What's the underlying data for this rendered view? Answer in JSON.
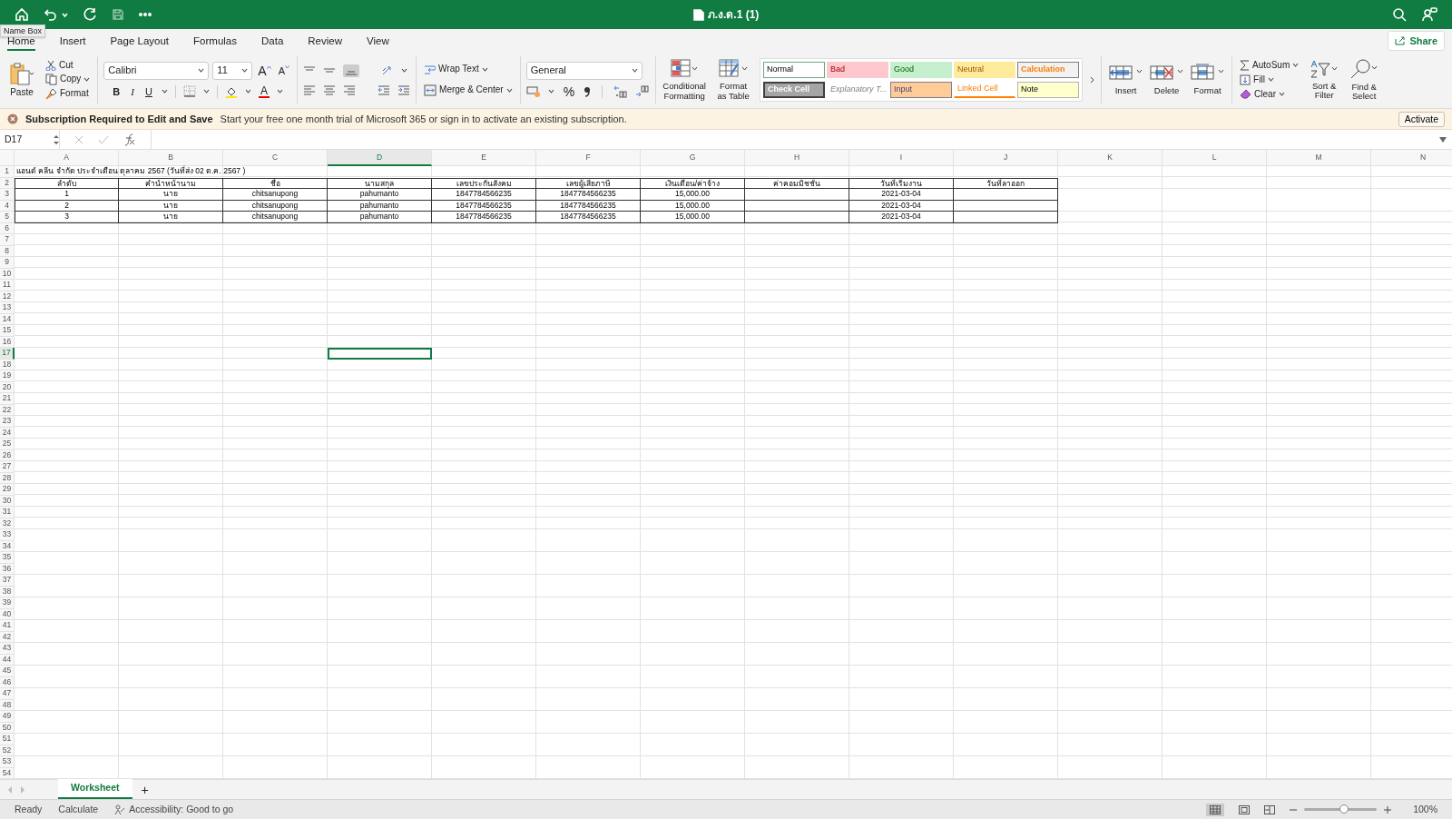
{
  "title_bar": {
    "title": "ภ.ง.ด.1 (1)"
  },
  "tooltip": "Name Box",
  "tabs": [
    {
      "label": "Home",
      "selected": true
    },
    {
      "label": "Insert",
      "selected": false
    },
    {
      "label": "Page Layout",
      "selected": false
    },
    {
      "label": "Formulas",
      "selected": false
    },
    {
      "label": "Data",
      "selected": false
    },
    {
      "label": "Review",
      "selected": false
    },
    {
      "label": "View",
      "selected": false
    }
  ],
  "share": "Share",
  "ribbon": {
    "clipboard": {
      "paste": "Paste",
      "cut": "Cut",
      "copy": "Copy",
      "format": "Format"
    },
    "font": {
      "name": "Calibri",
      "size": "11",
      "grow": "A",
      "shrink": "A",
      "bold": "B",
      "italic": "I",
      "underline": "U",
      "color_letter": "A"
    },
    "alignment": {
      "wrap": "Wrap Text",
      "merge": "Merge & Center"
    },
    "number": {
      "format": "General",
      "percent": "%"
    },
    "styles": {
      "conditional": "Conditional Formatting",
      "format_table": "Format as Table",
      "cells": [
        {
          "kind": "normal",
          "label": "Normal"
        },
        {
          "kind": "bad",
          "label": "Bad"
        },
        {
          "kind": "good",
          "label": "Good"
        },
        {
          "kind": "neutral",
          "label": "Neutral"
        },
        {
          "kind": "calculation",
          "label": "Calculation"
        },
        {
          "kind": "check",
          "label": "Check Cell"
        },
        {
          "kind": "explanatory",
          "label": "Explanatory T..."
        },
        {
          "kind": "input",
          "label": "Input"
        },
        {
          "kind": "linked",
          "label": "Linked Cell"
        },
        {
          "kind": "note",
          "label": "Note"
        }
      ]
    },
    "cells": [
      "Insert",
      "Delete",
      "Format"
    ],
    "editing": {
      "autosum": "AutoSum",
      "fill": "Fill",
      "clear": "Clear",
      "sort": "Sort & Filter",
      "find": "Find & Select"
    }
  },
  "banner": {
    "title": "Subscription Required to Edit and Save",
    "message": "Start your free one month trial of Microsoft 365 or sign in to activate an existing subscription.",
    "button": "Activate"
  },
  "formula_bar": {
    "name_box": "D17"
  },
  "sheet": {
    "columns": [
      {
        "label": "A",
        "selected": false
      },
      {
        "label": "B",
        "selected": false
      },
      {
        "label": "C",
        "selected": false
      },
      {
        "label": "D",
        "selected": true
      },
      {
        "label": "E",
        "selected": false
      },
      {
        "label": "F",
        "selected": false
      },
      {
        "label": "G",
        "selected": false
      },
      {
        "label": "H",
        "selected": false
      },
      {
        "label": "I",
        "selected": false
      },
      {
        "label": "J",
        "selected": false
      },
      {
        "label": "K",
        "selected": false
      },
      {
        "label": "L",
        "selected": false
      },
      {
        "label": "M",
        "selected": false
      },
      {
        "label": "N",
        "selected": false
      }
    ],
    "row_numbers": [
      {
        "label": "1",
        "selected": false
      },
      {
        "label": "2",
        "selected": false
      },
      {
        "label": "3",
        "selected": false
      },
      {
        "label": "4",
        "selected": false
      },
      {
        "label": "5",
        "selected": false
      },
      {
        "label": "6",
        "selected": false
      },
      {
        "label": "7",
        "selected": false
      },
      {
        "label": "8",
        "selected": false
      },
      {
        "label": "9",
        "selected": false
      },
      {
        "label": "10",
        "selected": false
      },
      {
        "label": "11",
        "selected": false
      },
      {
        "label": "12",
        "selected": false
      },
      {
        "label": "13",
        "selected": false
      },
      {
        "label": "14",
        "selected": false
      },
      {
        "label": "15",
        "selected": false
      },
      {
        "label": "16",
        "selected": false
      },
      {
        "label": "17",
        "selected": true
      },
      {
        "label": "18",
        "selected": false
      },
      {
        "label": "19",
        "selected": false
      },
      {
        "label": "20",
        "selected": false
      },
      {
        "label": "21",
        "selected": false
      },
      {
        "label": "22",
        "selected": false
      },
      {
        "label": "23",
        "selected": false
      },
      {
        "label": "24",
        "selected": false
      },
      {
        "label": "25",
        "selected": false
      },
      {
        "label": "26",
        "selected": false
      },
      {
        "label": "27",
        "selected": false
      },
      {
        "label": "28",
        "selected": false
      },
      {
        "label": "29",
        "selected": false
      },
      {
        "label": "30",
        "selected": false
      },
      {
        "label": "31",
        "selected": false
      },
      {
        "label": "32",
        "selected": false
      },
      {
        "label": "33",
        "selected": false
      },
      {
        "label": "34",
        "selected": false
      },
      {
        "label": "35",
        "selected": false
      },
      {
        "label": "36",
        "selected": false
      },
      {
        "label": "37",
        "selected": false
      },
      {
        "label": "38",
        "selected": false
      },
      {
        "label": "39",
        "selected": false
      },
      {
        "label": "40",
        "selected": false
      },
      {
        "label": "41",
        "selected": false
      },
      {
        "label": "42",
        "selected": false
      },
      {
        "label": "43",
        "selected": false
      },
      {
        "label": "44",
        "selected": false
      },
      {
        "label": "45",
        "selected": false
      },
      {
        "label": "46",
        "selected": false
      },
      {
        "label": "47",
        "selected": false
      },
      {
        "label": "48",
        "selected": false
      },
      {
        "label": "49",
        "selected": false
      },
      {
        "label": "50",
        "selected": false
      },
      {
        "label": "51",
        "selected": false
      },
      {
        "label": "52",
        "selected": false
      },
      {
        "label": "53",
        "selected": false
      },
      {
        "label": "54",
        "selected": false
      }
    ],
    "rows": [
      {
        "kind": "title",
        "cells": [
          "แอนด์ คลีน จำกัด ประจำเดือน ตุลาคม 2567 (วันที่ส่ง 02 ต.ค. 2567 )",
          null,
          null,
          null,
          null,
          null,
          null,
          null,
          null,
          null
        ]
      },
      {
        "kind": "header",
        "cells": [
          "ลำดับ",
          "คำนำหน้านาม",
          "ชื่อ",
          "นามสกุล",
          "เลขประกันสังคม",
          "เลขผู้เสียภาษี",
          "เงินเดือน/ค่าจ้าง",
          "ค่าคอมมิชชั่น",
          "วันที่เริ่มงาน",
          "วันที่ลาออก"
        ]
      },
      {
        "kind": "data",
        "cells": [
          "1",
          "นาย",
          "chitsanupong",
          "pahumanto",
          "1847784566235",
          "1847784566235",
          "15,000.00",
          null,
          "2021-03-04",
          null
        ]
      },
      {
        "kind": "data",
        "cells": [
          "2",
          "นาย",
          "chitsanupong",
          "pahumanto",
          "1847784566235",
          "1847784566235",
          "15,000.00",
          null,
          "2021-03-04",
          null
        ]
      },
      {
        "kind": "data",
        "cells": [
          "3",
          "นาย",
          "chitsanupong",
          "pahumanto",
          "1847784566235",
          "1847784566235",
          "15,000.00",
          null,
          "2021-03-04",
          null
        ]
      }
    ]
  },
  "sheet_tabs": [
    {
      "label": "Worksheet",
      "selected": true
    }
  ],
  "add_sheet": "+",
  "status_bar": {
    "items": [
      "Ready",
      "Calculate",
      "Accessibility: Good to go"
    ],
    "zoom": "100%",
    "zoom_slider": {
      "level": 0.55
    }
  }
}
